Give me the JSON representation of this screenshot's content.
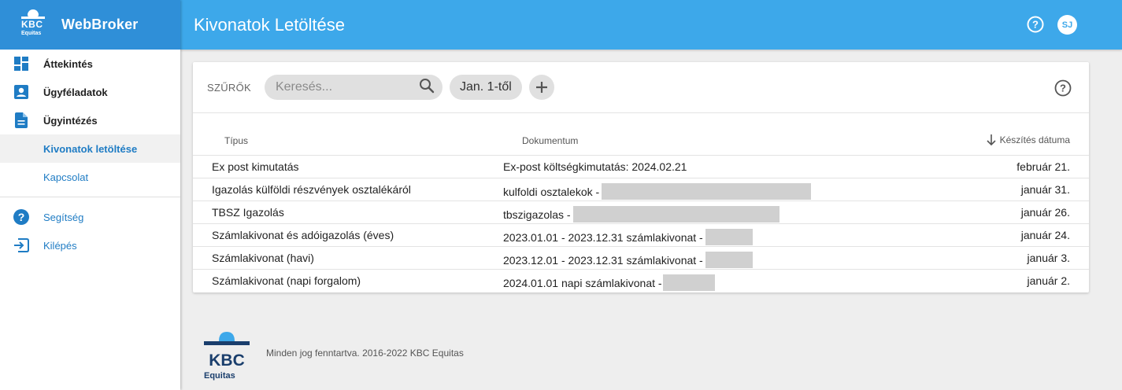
{
  "brand": {
    "logo_text": "KBC",
    "logo_sub": "Equitas",
    "app_name": "WebBroker",
    "color": "#2f8fd8"
  },
  "header": {
    "title": "Kivonatok Letöltése",
    "help_icon": "help-circle-icon",
    "avatar_initials": "SJ",
    "color": "#3da8ea"
  },
  "sidebar": {
    "items": [
      {
        "label": "Áttekintés",
        "icon": "dashboard-icon"
      },
      {
        "label": "Ügyféladatok",
        "icon": "account-box-icon"
      },
      {
        "label": "Ügyintézés",
        "icon": "document-icon"
      }
    ],
    "subitems": [
      {
        "label": "Kivonatok letöltése",
        "active": true
      },
      {
        "label": "Kapcsolat",
        "active": false
      }
    ],
    "links": [
      {
        "label": "Segítség",
        "icon": "help-icon"
      },
      {
        "label": "Kilépés",
        "icon": "exit-icon"
      }
    ]
  },
  "filters": {
    "label": "SZŰRŐK",
    "search_placeholder": "Keresés...",
    "date_chip": "Jan. 1-től"
  },
  "table": {
    "headers": {
      "type": "Típus",
      "document": "Dokumentum",
      "date": "Készítés dátuma"
    },
    "sort": "descending",
    "rows": [
      {
        "type": "Ex post kimutatás",
        "document": "Ex-post költségkimutatás: 2024.02.21",
        "date": "február 21.",
        "redacted": false
      },
      {
        "type": "Igazolás külföldi részvények osztalékáról",
        "document": "kulfoldi osztalekok -",
        "date": "január 31.",
        "redacted": true
      },
      {
        "type": "TBSZ Igazolás",
        "document": "tbszigazolas -",
        "date": "január 26.",
        "redacted": true
      },
      {
        "type": "Számlakivonat és adóigazolás (éves)",
        "document": "2023.01.01 - 2023.12.31 számlakivonat -",
        "date": "január 24.",
        "redacted": true
      },
      {
        "type": "Számlakivonat (havi)",
        "document": "2023.12.01 - 2023.12.31 számlakivonat -",
        "date": "január 3.",
        "redacted": true
      },
      {
        "type": "Számlakivonat (napi forgalom)",
        "document": "2024.01.01 napi számlakivonat -",
        "date": "január 2.",
        "redacted": true
      }
    ]
  },
  "footer": {
    "logo_text": "KBC",
    "logo_sub": "Equitas",
    "copyright": "Minden jog fenntartva. 2016-2022 KBC Equitas"
  }
}
